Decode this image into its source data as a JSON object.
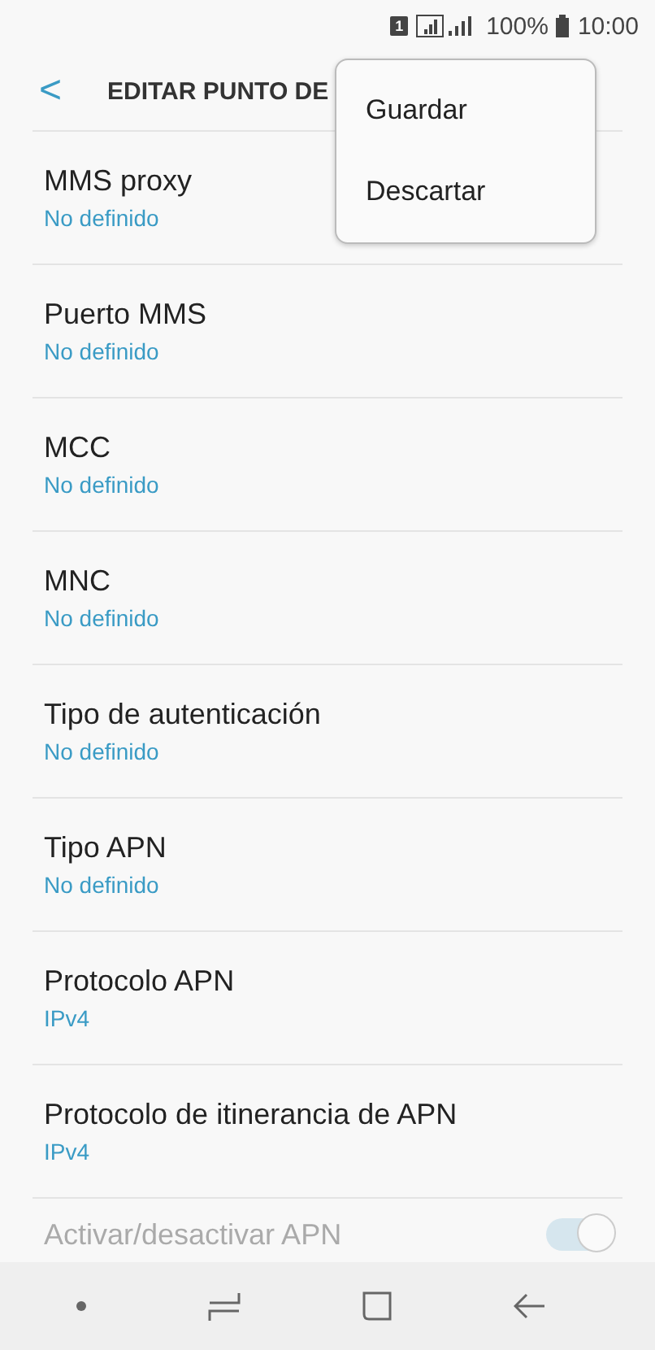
{
  "status_bar": {
    "sim": "1",
    "battery": "100%",
    "time": "10:00"
  },
  "header": {
    "back": "<",
    "title": "EDITAR PUNTO DE"
  },
  "menu": {
    "items": [
      "Guardar",
      "Descartar"
    ]
  },
  "settings": [
    {
      "kind": "value",
      "label": "MMS proxy",
      "value": "No definido"
    },
    {
      "kind": "value",
      "label": "Puerto MMS",
      "value": "No definido"
    },
    {
      "kind": "value",
      "label": "MCC",
      "value": "No definido"
    },
    {
      "kind": "value",
      "label": "MNC",
      "value": "No definido"
    },
    {
      "kind": "value",
      "label": "Tipo de autenticación",
      "value": "No definido"
    },
    {
      "kind": "value",
      "label": "Tipo APN",
      "value": "No definido"
    },
    {
      "kind": "value",
      "label": "Protocolo APN",
      "value": "IPv4"
    },
    {
      "kind": "value",
      "label": "Protocolo de itinerancia de APN",
      "value": "IPv4"
    },
    {
      "kind": "switch",
      "label": "Activar/desactivar APN",
      "on": true,
      "disabled": true
    }
  ]
}
